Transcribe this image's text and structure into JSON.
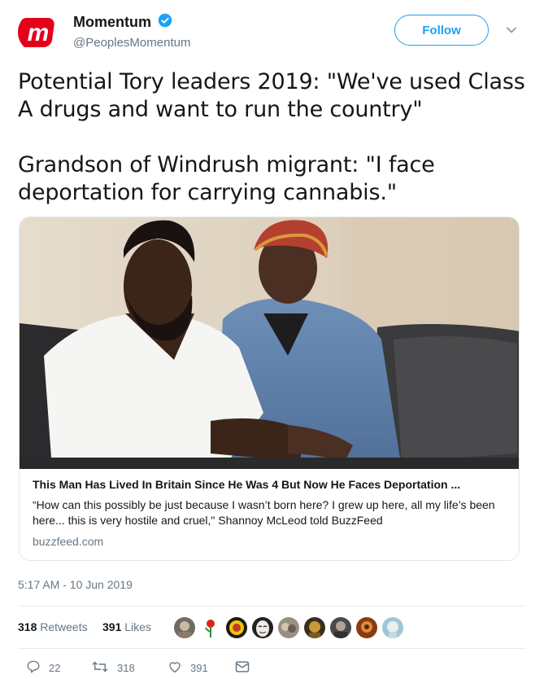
{
  "account": {
    "display_name": "Momentum",
    "handle": "@PeoplesMomentum",
    "verified": true,
    "avatar_icon": "momentum-logo",
    "brand_color": "#e3001b"
  },
  "follow_button": {
    "label": "Follow"
  },
  "tweet": {
    "paragraphs": [
      "Potential Tory leaders 2019: \"We've used Class A drugs and want to run the country\"",
      "Grandson of Windrush migrant: \"I face deportation for carrying cannabis.\""
    ]
  },
  "card": {
    "title": "This Man Has Lived In Britain Since He Was 4 But Now He Faces Deportation ...",
    "description": "“How can this possibly be just because I wasn’t born here? I grew up here, all my life’s been here... this is very hostile and cruel,\" Shannoy McLeod told BuzzFeed",
    "domain": "buzzfeed.com"
  },
  "timestamp": "5:17 AM - 10 Jun 2019",
  "stats": {
    "retweets_count": "318",
    "retweets_label": "Retweets",
    "likes_count": "391",
    "likes_label": "Likes"
  },
  "actions": {
    "replies": "22",
    "retweets": "318",
    "likes": "391"
  },
  "colors": {
    "accent": "#1da1f2",
    "secondary_text": "#657786"
  }
}
